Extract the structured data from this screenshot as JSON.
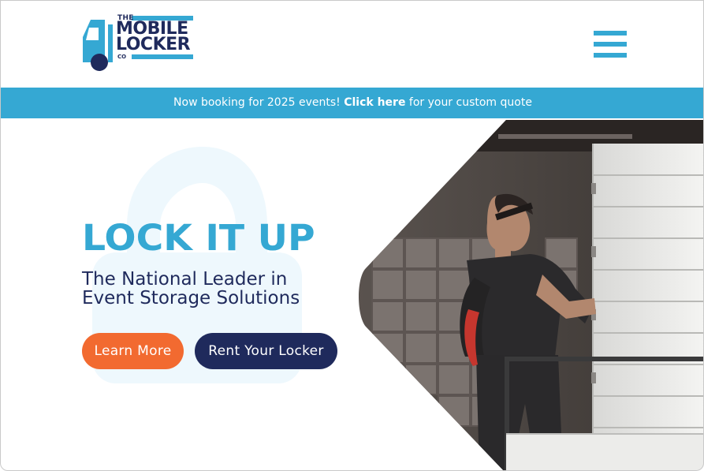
{
  "brand": {
    "logo_the": "THE",
    "logo_mobile": "MOBILE",
    "logo_locker": "LOCKER",
    "logo_co": "CO",
    "primary_color": "#35a8d3",
    "navy_color": "#1f2a5c",
    "accent_color": "#f26a30"
  },
  "header": {
    "menu_icon": "hamburger-menu-icon"
  },
  "announcement": {
    "text_before": "Now booking for 2025 events! ",
    "link_label": "Click here",
    "text_after": " for your custom quote"
  },
  "hero": {
    "headline": "LOCK IT UP",
    "subheadline": "The National Leader in Event Storage Solutions",
    "learn_more_label": "Learn More",
    "rent_locker_label": "Rent Your Locker",
    "background_icon": "padlock-icon",
    "image_description_icon": "hero-photo"
  }
}
